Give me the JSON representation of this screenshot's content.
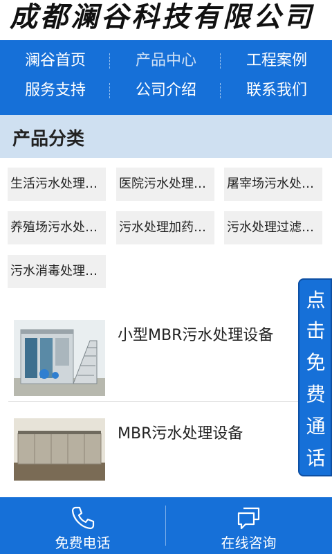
{
  "header": {
    "logo_text": "成都澜谷科技有限公司"
  },
  "nav": {
    "items": [
      {
        "label": "澜谷首页"
      },
      {
        "label": "产品中心"
      },
      {
        "label": "工程案例"
      },
      {
        "label": "服务支持"
      },
      {
        "label": "公司介绍"
      },
      {
        "label": "联系我们"
      }
    ],
    "active_index": 1
  },
  "categories": {
    "title": "产品分类",
    "items": [
      {
        "label": "生活污水处理设备"
      },
      {
        "label": "医院污水处理设备"
      },
      {
        "label": "屠宰场污水处理设备"
      },
      {
        "label": "养殖场污水处理设备"
      },
      {
        "label": "污水处理加药设备"
      },
      {
        "label": "污水处理过滤设备"
      },
      {
        "label": "污水消毒处理设备"
      }
    ]
  },
  "products": [
    {
      "name": "小型MBR污水处理设备"
    },
    {
      "name": "MBR污水处理设备"
    }
  ],
  "float_call": {
    "chars": [
      "点",
      "击",
      "免",
      "费",
      "通",
      "话"
    ]
  },
  "bottom_bar": {
    "call_label": "免费电话",
    "consult_label": "在线咨询",
    "call_icon": "phone-icon",
    "consult_icon": "chat-icon"
  },
  "colors": {
    "primary": "#1670d8",
    "category_header_bg": "#cfe0f1",
    "chip_bg": "#f0f0f0"
  }
}
